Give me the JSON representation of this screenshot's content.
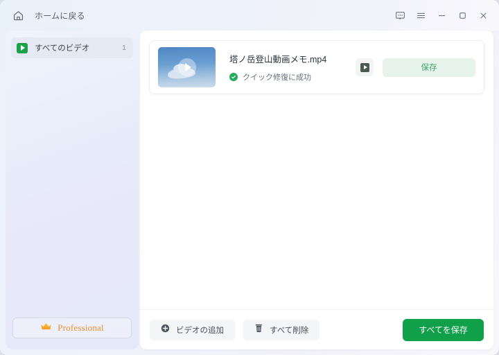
{
  "titlebar": {
    "home_icon": "home-icon",
    "home_label": "ホームに戻る",
    "controls": [
      {
        "name": "feedback-icon",
        "label": "feedback"
      },
      {
        "name": "menu-icon",
        "label": "menu"
      },
      {
        "name": "minimize-icon",
        "label": "minimize"
      },
      {
        "name": "maximize-icon",
        "label": "maximize"
      },
      {
        "name": "close-icon",
        "label": "close"
      }
    ]
  },
  "sidebar": {
    "items": [
      {
        "icon": "video-play-icon",
        "label": "すべてのビデオ",
        "count": "1",
        "selected": true
      }
    ],
    "pro_button": {
      "icon": "crown-icon",
      "label": "Professional"
    }
  },
  "main": {
    "videos": [
      {
        "thumbnail": "sky-cloud-video-thumbnail",
        "name": "塔ノ岳登山動画メモ.mp4",
        "status_icon": "check-circle-icon",
        "status": "クイック修復に成功",
        "preview_button": "play-icon",
        "save_label": "保存"
      }
    ]
  },
  "bottombar": {
    "add_video": {
      "icon": "plus-circle-icon",
      "label": "ビデオの追加"
    },
    "delete_all": {
      "icon": "trash-icon",
      "label": "すべて削除"
    },
    "save_all": {
      "label": "すべてを保存"
    }
  },
  "colors": {
    "brand_green": "#11a04a",
    "save_green_text": "#3ea36a",
    "save_green_bg": "#e6f4ec",
    "pro_orange": "#e8922c",
    "status_green": "#22ab5c"
  }
}
